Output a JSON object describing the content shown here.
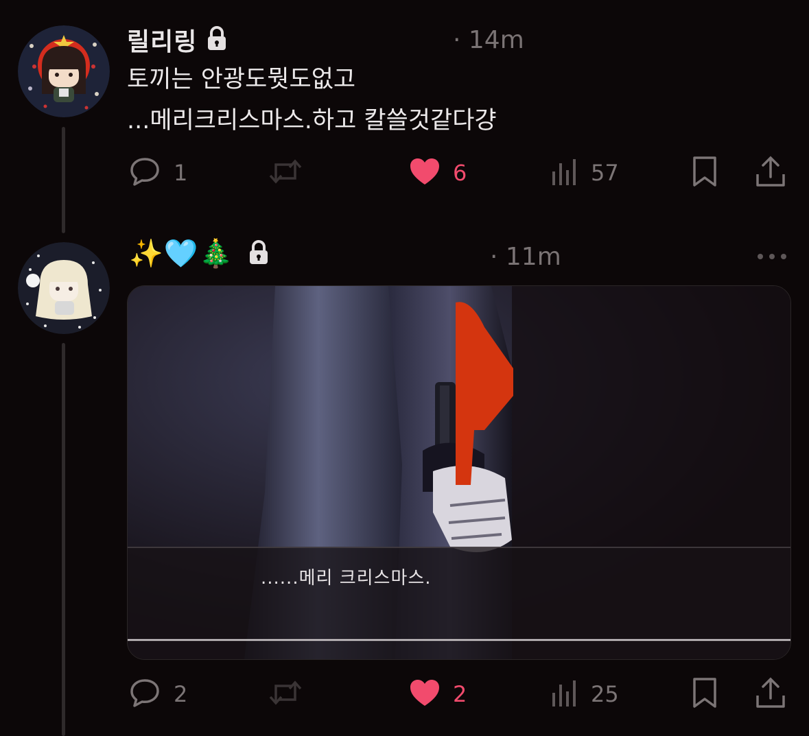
{
  "posts": [
    {
      "username": "릴리링",
      "timestamp": "· 14m",
      "text_line1": "토끼는 안광도뭣도없고",
      "text_line2": "...메리크리스마스.하고 칼쓸것같다걍",
      "replies": "1",
      "likes": "6",
      "views": "57"
    },
    {
      "username": "✨🩵🎄",
      "timestamp": "· 11m",
      "image_caption": "......메리 크리스마스.",
      "replies": "2",
      "likes": "2",
      "views": "25"
    }
  ],
  "colors": {
    "background": "#0c0708",
    "like_active": "#f24b6d",
    "muted": "#7c7576",
    "knife_red": "#d4350f"
  },
  "icons": [
    "lock-icon",
    "reply-icon",
    "repost-icon",
    "heart-icon",
    "views-icon",
    "bookmark-icon",
    "share-icon",
    "more-icon"
  ]
}
